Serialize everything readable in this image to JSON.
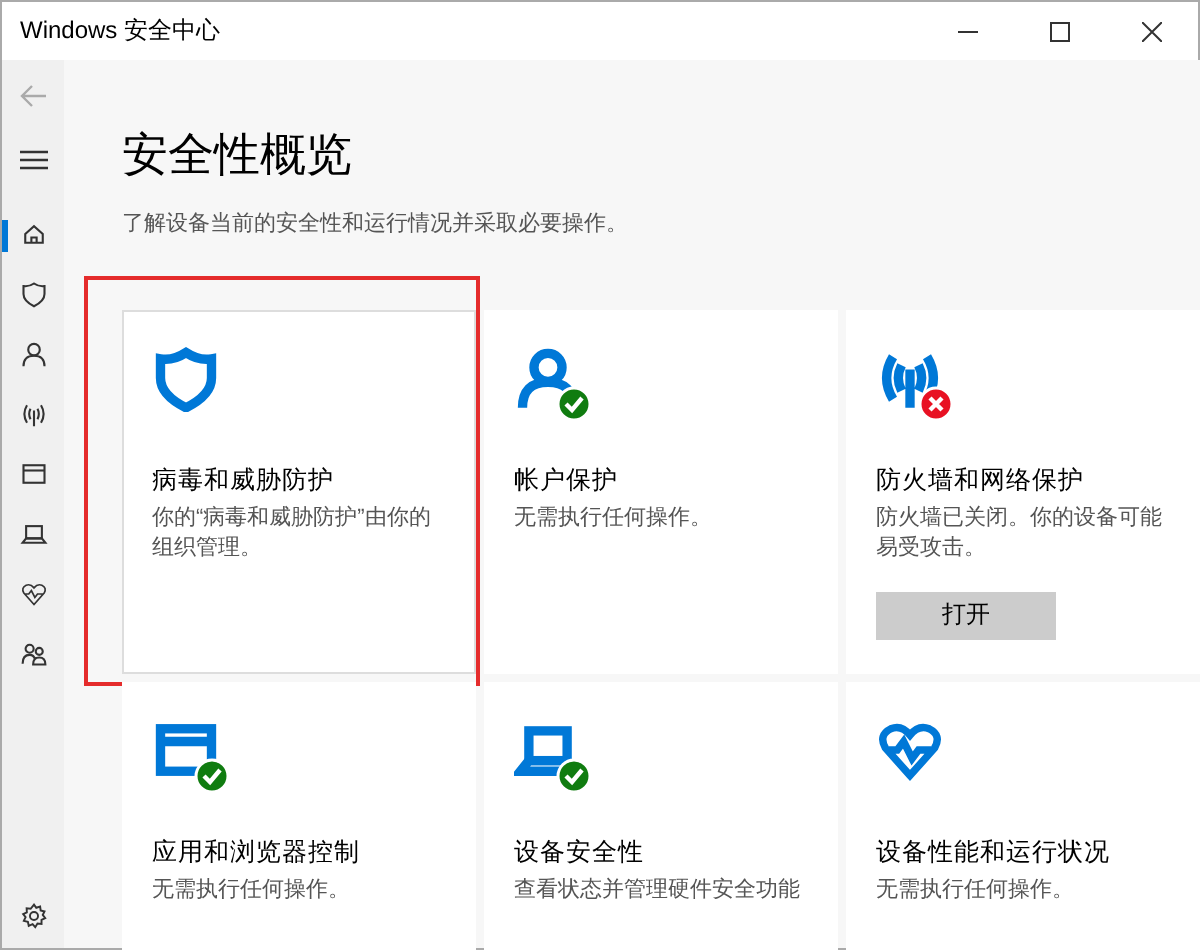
{
  "window": {
    "title": "Windows 安全中心"
  },
  "sidebar": {
    "items": [
      {
        "kind": "home",
        "selected": true
      },
      {
        "kind": "shield",
        "selected": false
      },
      {
        "kind": "person",
        "selected": false
      },
      {
        "kind": "antenna",
        "selected": false
      },
      {
        "kind": "browser",
        "selected": false
      },
      {
        "kind": "laptop",
        "selected": false
      },
      {
        "kind": "heart",
        "selected": false
      },
      {
        "kind": "family",
        "selected": false
      }
    ]
  },
  "page": {
    "heading": "安全性概览",
    "subtitle": "了解设备当前的安全性和运行情况并采取必要操作。"
  },
  "cards": [
    {
      "kind": "shield",
      "highlighted": true,
      "title": "病毒和威胁防护",
      "description": "你的“病毒和威胁防护”由你的组织管理。"
    },
    {
      "kind": "person",
      "badge": {
        "kind": "check"
      },
      "highlighted": false,
      "title": "帐户保护",
      "description": "无需执行任何操作。"
    },
    {
      "kind": "antenna",
      "badge": {
        "kind": "cross"
      },
      "highlighted": false,
      "title": "防火墙和网络保护",
      "description": "防火墙已关闭。你的设备可能易受攻击。",
      "button": "打开"
    },
    {
      "kind": "browser",
      "badge": {
        "kind": "check"
      },
      "highlighted": false,
      "title": "应用和浏览器控制",
      "description": "无需执行任何操作。"
    },
    {
      "kind": "laptop",
      "badge": {
        "kind": "check"
      },
      "highlighted": false,
      "title": "设备安全性",
      "description": "查看状态并管理硬件安全功能"
    },
    {
      "kind": "heart",
      "highlighted": false,
      "title": "设备性能和运行状况",
      "description": "无需执行任何操作。"
    }
  ]
}
